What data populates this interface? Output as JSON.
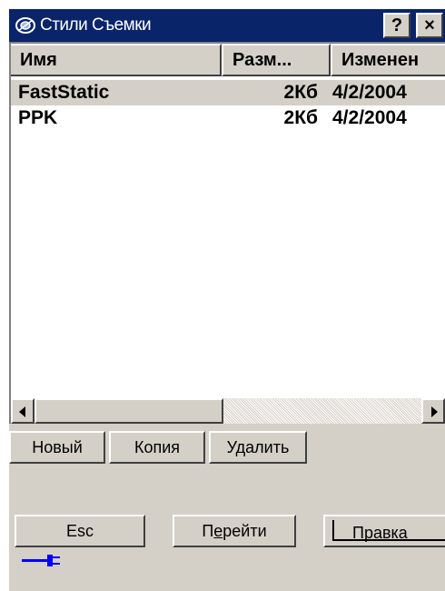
{
  "window": {
    "title": "Стили Съемки"
  },
  "titlebar": {
    "help_label": "?",
    "close_label": "×"
  },
  "list": {
    "columns": [
      "Имя",
      "Разм...",
      "Изменен"
    ],
    "rows": [
      {
        "name": "FastStatic",
        "size": "2Кб",
        "modified": "4/2/2004",
        "selected": true
      },
      {
        "name": "PPK",
        "size": "2Кб",
        "modified": "4/2/2004",
        "selected": false
      }
    ]
  },
  "actions": {
    "new": "Новый",
    "copy": "Копия",
    "delete": "Удалить"
  },
  "softkeys": {
    "esc": "Esc",
    "go_prefix": "П",
    "go_accel": "е",
    "go_suffix": "рейти",
    "edit": "Правка"
  },
  "colors": {
    "titlebar": "#0a246a",
    "face": "#d4d0c8",
    "plug": "#0000ff"
  },
  "icons": [
    "app-logo-icon",
    "help-icon",
    "close-icon",
    "scroll-left-icon",
    "scroll-right-icon",
    "power-plug-icon"
  ]
}
